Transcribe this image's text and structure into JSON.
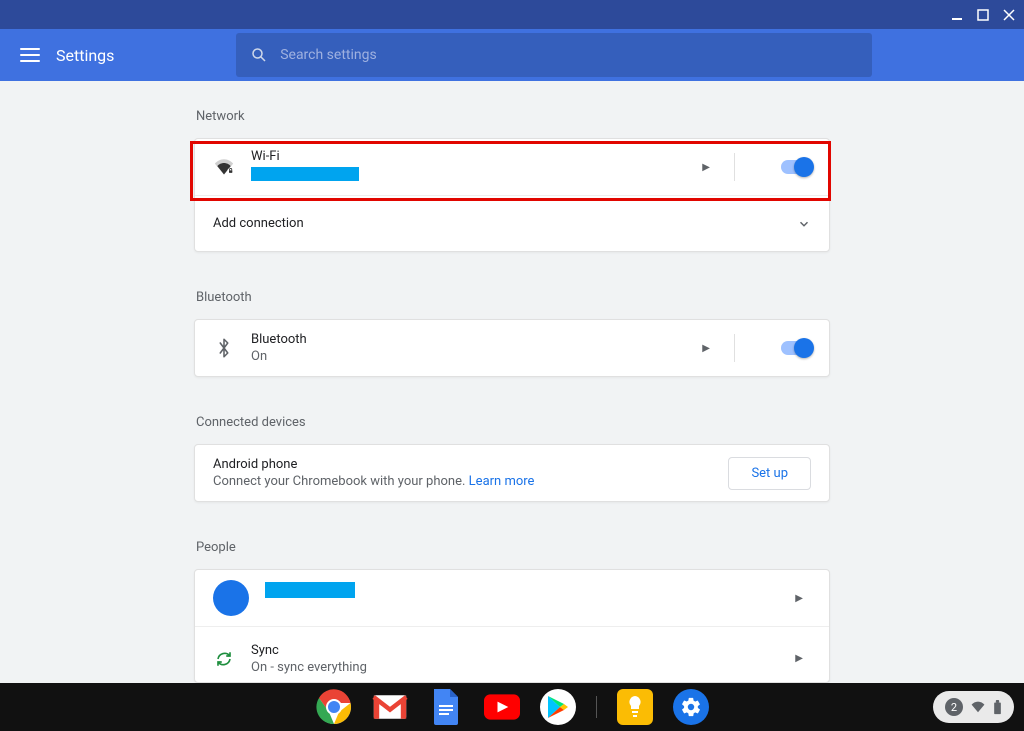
{
  "window": {
    "title": "Settings"
  },
  "header": {
    "app_title": "Settings",
    "search_placeholder": "Search settings"
  },
  "sections": {
    "network": {
      "label": "Network",
      "wifi": {
        "title": "Wi-Fi",
        "toggled": true
      },
      "add_connection": {
        "title": "Add connection"
      }
    },
    "bluetooth": {
      "label": "Bluetooth",
      "row": {
        "title": "Bluetooth",
        "sub": "On",
        "toggled": true
      }
    },
    "connected_devices": {
      "label": "Connected devices",
      "android": {
        "title": "Android phone",
        "sub": "Connect your Chromebook with your phone. ",
        "learn_more": "Learn more",
        "setup": "Set up"
      }
    },
    "people": {
      "label": "People",
      "sync": {
        "title": "Sync",
        "sub": "On - sync everything"
      }
    }
  },
  "taskbar": {
    "tray_count": "2"
  }
}
